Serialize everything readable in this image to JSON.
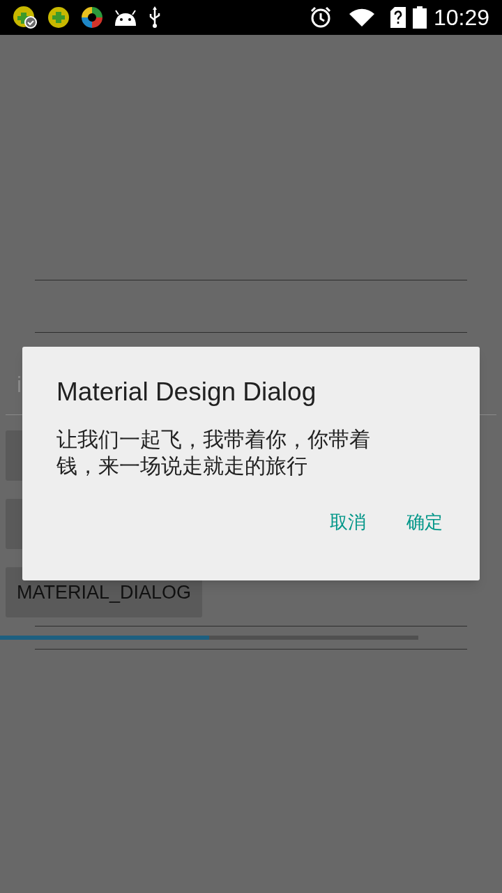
{
  "status_bar": {
    "time": "10:29"
  },
  "background": {
    "field_text": "i",
    "buttons": [
      "MATERIAL_DIALOG"
    ],
    "progress": {
      "level": 0.5
    }
  },
  "dialog": {
    "title": "Material Design Dialog",
    "message": "让我们一起飞，我带着你，你带着钱，来一场说走就走的旅行",
    "buttons": [
      "取消",
      "确定"
    ]
  }
}
